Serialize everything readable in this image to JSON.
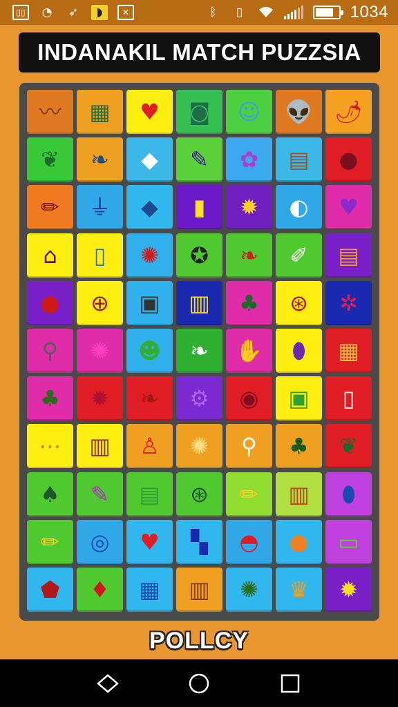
{
  "status_bar": {
    "left_icons": [
      "gallery-icon",
      "sync-icon",
      "send-icon",
      "app-icon",
      "photo-icon"
    ],
    "right_icons": [
      "bluetooth-icon",
      "vibrate-icon",
      "wifi-icon",
      "signal-icon",
      "battery-icon"
    ],
    "time": "1034"
  },
  "title": "INDANAKIL MATCH PUZZSIA",
  "bottom_label": "POLLCY",
  "colors": {
    "background": "#e8962e",
    "status_bar": "#b86d14",
    "board": "#4a4a4a",
    "title_bg": "#111111"
  },
  "board": {
    "rows": 11,
    "cols": 7,
    "tiles": [
      [
        {
          "icon": "waveform-icon",
          "bg": "#e07a22",
          "glyph": "〰",
          "fg": "#7a3a10"
        },
        {
          "icon": "grid-icon",
          "bg": "#f0a020",
          "glyph": "▦",
          "fg": "#2a6b3a"
        },
        {
          "icon": "heart-icon",
          "bg": "#ffee10",
          "glyph": "♥",
          "fg": "#e01c24"
        },
        {
          "icon": "washer-icon",
          "bg": "#35c050",
          "glyph": "◙",
          "fg": "#1e6e4a"
        },
        {
          "icon": "face-icon",
          "bg": "#4cd040",
          "glyph": "☺",
          "fg": "#3ba0e0"
        },
        {
          "icon": "alien-icon",
          "bg": "#e07a22",
          "glyph": "👽",
          "fg": "#f05aa0"
        },
        {
          "icon": "chili-icon",
          "bg": "#f5a020",
          "glyph": "🌶",
          "fg": "#d01818"
        }
      ],
      [
        {
          "icon": "leaf-icon",
          "bg": "#38c838",
          "glyph": "❦",
          "fg": "#1e6a2a"
        },
        {
          "icon": "feather-icon",
          "bg": "#f0a020",
          "glyph": "❧",
          "fg": "#1f4f8a"
        },
        {
          "icon": "fish-icon",
          "bg": "#3cb8e8",
          "glyph": "◆",
          "fg": "#ffffff"
        },
        {
          "icon": "pen-icon",
          "bg": "#5ad03a",
          "glyph": "✎",
          "fg": "#3a1aa0"
        },
        {
          "icon": "flower-icon",
          "bg": "#3ca8f0",
          "glyph": "✿",
          "fg": "#b03ad0"
        },
        {
          "icon": "book-icon",
          "bg": "#3cb8e8",
          "glyph": "▤",
          "fg": "#a0522d"
        },
        {
          "icon": "fruit-icon",
          "bg": "#e01c24",
          "glyph": "●",
          "fg": "#7a1020"
        }
      ],
      [
        {
          "icon": "pencil-icon",
          "bg": "#f07a20",
          "glyph": "✏",
          "fg": "#7a1010"
        },
        {
          "icon": "plug-icon",
          "bg": "#30a8e8",
          "glyph": "⏚",
          "fg": "#1a3a90"
        },
        {
          "icon": "fish-icon",
          "bg": "#30b8ee",
          "glyph": "◆",
          "fg": "#1a4a90"
        },
        {
          "icon": "phone-icon",
          "bg": "#6a18c8",
          "glyph": "▮",
          "fg": "#ffe020"
        },
        {
          "icon": "star-icon",
          "bg": "#7020c0",
          "glyph": "✹",
          "fg": "#ffd020"
        },
        {
          "icon": "globe-icon",
          "bg": "#30a8e8",
          "glyph": "◐",
          "fg": "#ffffff"
        },
        {
          "icon": "heart-icon",
          "bg": "#e02ca8",
          "glyph": "♥",
          "fg": "#8a2ad0"
        }
      ],
      [
        {
          "icon": "building-icon",
          "bg": "#ffee10",
          "glyph": "⌂",
          "fg": "#6a1010"
        },
        {
          "icon": "tablet-icon",
          "bg": "#ffee10",
          "glyph": "▯",
          "fg": "#2a70d0"
        },
        {
          "icon": "gear-icon",
          "bg": "#30b0ec",
          "glyph": "✺",
          "fg": "#d01818"
        },
        {
          "icon": "star-badge-icon",
          "bg": "#50c830",
          "glyph": "✪",
          "fg": "#222222"
        },
        {
          "icon": "leaf-icon",
          "bg": "#50c830",
          "glyph": "❧",
          "fg": "#d02020"
        },
        {
          "icon": "crayon-icon",
          "bg": "#50c830",
          "glyph": "✐",
          "fg": "#ffffff"
        },
        {
          "icon": "scroll-icon",
          "bg": "#7a20c8",
          "glyph": "▤",
          "fg": "#f0a020"
        }
      ],
      [
        {
          "icon": "pomegranate-icon",
          "bg": "#7a20c8",
          "glyph": "●",
          "fg": "#d01818"
        },
        {
          "icon": "compass-icon",
          "bg": "#ffee10",
          "glyph": "⊕",
          "fg": "#a01818"
        },
        {
          "icon": "gadget-icon",
          "bg": "#30b0ec",
          "glyph": "▣",
          "fg": "#333333"
        },
        {
          "icon": "book-icon",
          "bg": "#1a2ab0",
          "glyph": "▥",
          "fg": "#ffe020"
        },
        {
          "icon": "palm-icon",
          "bg": "#e02ca8",
          "glyph": "♣",
          "fg": "#1a6a2a"
        },
        {
          "icon": "wheel-icon",
          "bg": "#ffee10",
          "glyph": "⊛",
          "fg": "#b01818"
        },
        {
          "icon": "berries-icon",
          "bg": "#1a2ab0",
          "glyph": "✲",
          "fg": "#e01c50"
        }
      ],
      [
        {
          "icon": "magnifier-icon",
          "bg": "#e02ca8",
          "glyph": "⚲",
          "fg": "#5a5a5a"
        },
        {
          "icon": "splash-icon",
          "bg": "#e02ca8",
          "glyph": "✺",
          "fg": "#ff40c0"
        },
        {
          "icon": "face-icon",
          "bg": "#30b0ec",
          "glyph": "☻",
          "fg": "#30b030"
        },
        {
          "icon": "feather-icon",
          "bg": "#30b030",
          "glyph": "❧",
          "fg": "#ffffff"
        },
        {
          "icon": "hand-icon",
          "bg": "#e02ca8",
          "glyph": "✋",
          "fg": "#b01040"
        },
        {
          "icon": "eggplant-icon",
          "bg": "#ffee10",
          "glyph": "⬮",
          "fg": "#6a2ab0"
        },
        {
          "icon": "radio-icon",
          "bg": "#e01c24",
          "glyph": "▦",
          "fg": "#f0c040"
        }
      ],
      [
        {
          "icon": "palm-icon",
          "bg": "#e02ca8",
          "glyph": "♣",
          "fg": "#2a6a1a"
        },
        {
          "icon": "gear-icon",
          "bg": "#e01c24",
          "glyph": "✹",
          "fg": "#b01030"
        },
        {
          "icon": "chili-icon",
          "bg": "#e01c24",
          "glyph": "❧",
          "fg": "#a01818"
        },
        {
          "icon": "cog-icon",
          "bg": "#7a2ad0",
          "glyph": "⚙",
          "fg": "#b060f0"
        },
        {
          "icon": "spiral-icon",
          "bg": "#e01c24",
          "glyph": "◉",
          "fg": "#801020"
        },
        {
          "icon": "card-icon",
          "bg": "#ffee10",
          "glyph": "▣",
          "fg": "#30a030"
        },
        {
          "icon": "smartphone-icon",
          "bg": "#e01c24",
          "glyph": "▯",
          "fg": "#ffffff"
        }
      ],
      [
        {
          "icon": "dots-icon",
          "bg": "#ffee10",
          "glyph": "⋯",
          "fg": "#e07a20"
        },
        {
          "icon": "door-icon",
          "bg": "#ffee10",
          "glyph": "▥",
          "fg": "#8a2a10"
        },
        {
          "icon": "robot-icon",
          "bg": "#f0a020",
          "glyph": "♙",
          "fg": "#e02020"
        },
        {
          "icon": "citrus-icon",
          "bg": "#f0a020",
          "glyph": "✺",
          "fg": "#ffe080"
        },
        {
          "icon": "magnifier-icon",
          "bg": "#f0a020",
          "glyph": "⚲",
          "fg": "#ffffff"
        },
        {
          "icon": "palm-icon",
          "bg": "#f0a020",
          "glyph": "♣",
          "fg": "#1a5a1a"
        },
        {
          "icon": "leaf-icon",
          "bg": "#e01c24",
          "glyph": "❦",
          "fg": "#1a6a2a"
        }
      ],
      [
        {
          "icon": "alien-icon",
          "bg": "#50c830",
          "glyph": "♠",
          "fg": "#1a5a2a"
        },
        {
          "icon": "marker-icon",
          "bg": "#50c830",
          "glyph": "✎",
          "fg": "#b030c0"
        },
        {
          "icon": "notepad-icon",
          "bg": "#50c830",
          "glyph": "▤",
          "fg": "#30a030"
        },
        {
          "icon": "dial-icon",
          "bg": "#50c830",
          "glyph": "⊛",
          "fg": "#1a5a2a"
        },
        {
          "icon": "crayon-icon",
          "bg": "#90dc30",
          "glyph": "✏",
          "fg": "#ffd020"
        },
        {
          "icon": "crate-icon",
          "bg": "#b0e040",
          "glyph": "▥",
          "fg": "#c04020"
        },
        {
          "icon": "bottle-icon",
          "bg": "#c040e0",
          "glyph": "⬮",
          "fg": "#1a4ab0"
        }
      ],
      [
        {
          "icon": "crayon-icon",
          "bg": "#50c830",
          "glyph": "✏",
          "fg": "#ffd020"
        },
        {
          "icon": "compass-icon",
          "bg": "#30a8e8",
          "glyph": "◎",
          "fg": "#1a4ab0"
        },
        {
          "icon": "heart-icon",
          "bg": "#30b8ee",
          "glyph": "♥",
          "fg": "#e01c24"
        },
        {
          "icon": "mosaic-icon",
          "bg": "#30b8ee",
          "glyph": "▚",
          "fg": "#1a2ab0"
        },
        {
          "icon": "mouth-icon",
          "bg": "#30a8e8",
          "glyph": "◓",
          "fg": "#e01c24"
        },
        {
          "icon": "pumpkin-icon",
          "bg": "#30b8ee",
          "glyph": "●",
          "fg": "#f08020"
        },
        {
          "icon": "money-icon",
          "bg": "#c040e0",
          "glyph": "▭",
          "fg": "#60d030"
        }
      ],
      [
        {
          "icon": "shield-icon",
          "bg": "#30b8ee",
          "glyph": "⬟",
          "fg": "#b01818"
        },
        {
          "icon": "bird-icon",
          "bg": "#50c830",
          "glyph": "♦",
          "fg": "#d01818"
        },
        {
          "icon": "calendar-icon",
          "bg": "#30b8ee",
          "glyph": "▦",
          "fg": "#1a4ab0"
        },
        {
          "icon": "box-icon",
          "bg": "#f0a020",
          "glyph": "▥",
          "fg": "#8a3a10"
        },
        {
          "icon": "sunflower-icon",
          "bg": "#30b8ee",
          "glyph": "✺",
          "fg": "#2a6a1a"
        },
        {
          "icon": "crown-icon",
          "bg": "#30b8ee",
          "glyph": "♛",
          "fg": "#f0a020"
        },
        {
          "icon": "star-icon",
          "bg": "#7a20c8",
          "glyph": "✹",
          "fg": "#ffe020"
        }
      ]
    ]
  },
  "nav": [
    "back-icon",
    "home-icon",
    "recents-icon"
  ]
}
